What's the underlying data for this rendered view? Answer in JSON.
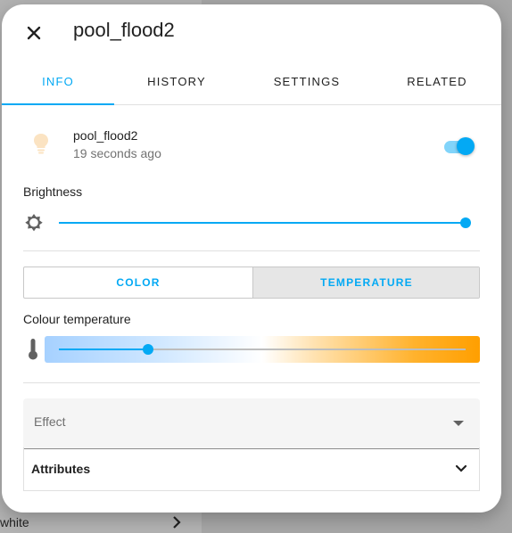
{
  "background": {
    "row_text": "white"
  },
  "dialog": {
    "title": "pool_flood2",
    "tabs": [
      {
        "label": "INFO",
        "active": true
      },
      {
        "label": "HISTORY",
        "active": false
      },
      {
        "label": "SETTINGS",
        "active": false
      },
      {
        "label": "RELATED",
        "active": false
      }
    ],
    "entity": {
      "name": "pool_flood2",
      "last_changed": "19 seconds ago",
      "state_on": true
    },
    "brightness": {
      "label": "Brightness",
      "value_fraction": 1.0
    },
    "color_mode": {
      "options": [
        "COLOR",
        "TEMPERATURE"
      ],
      "selected": "TEMPERATURE"
    },
    "colour_temperature": {
      "label": "Colour temperature",
      "value_fraction": 0.21
    },
    "effect": {
      "label": "Effect"
    },
    "attributes": {
      "label": "Attributes"
    }
  },
  "colors": {
    "accent": "#03a9f4",
    "bulb": "#fbe3c2"
  },
  "icons": {
    "close": "close-icon",
    "bulb": "lightbulb-icon",
    "brightness": "brightness-icon",
    "thermometer": "thermometer-icon",
    "dropdown": "caret-down-icon",
    "expand": "chevron-down-icon"
  }
}
